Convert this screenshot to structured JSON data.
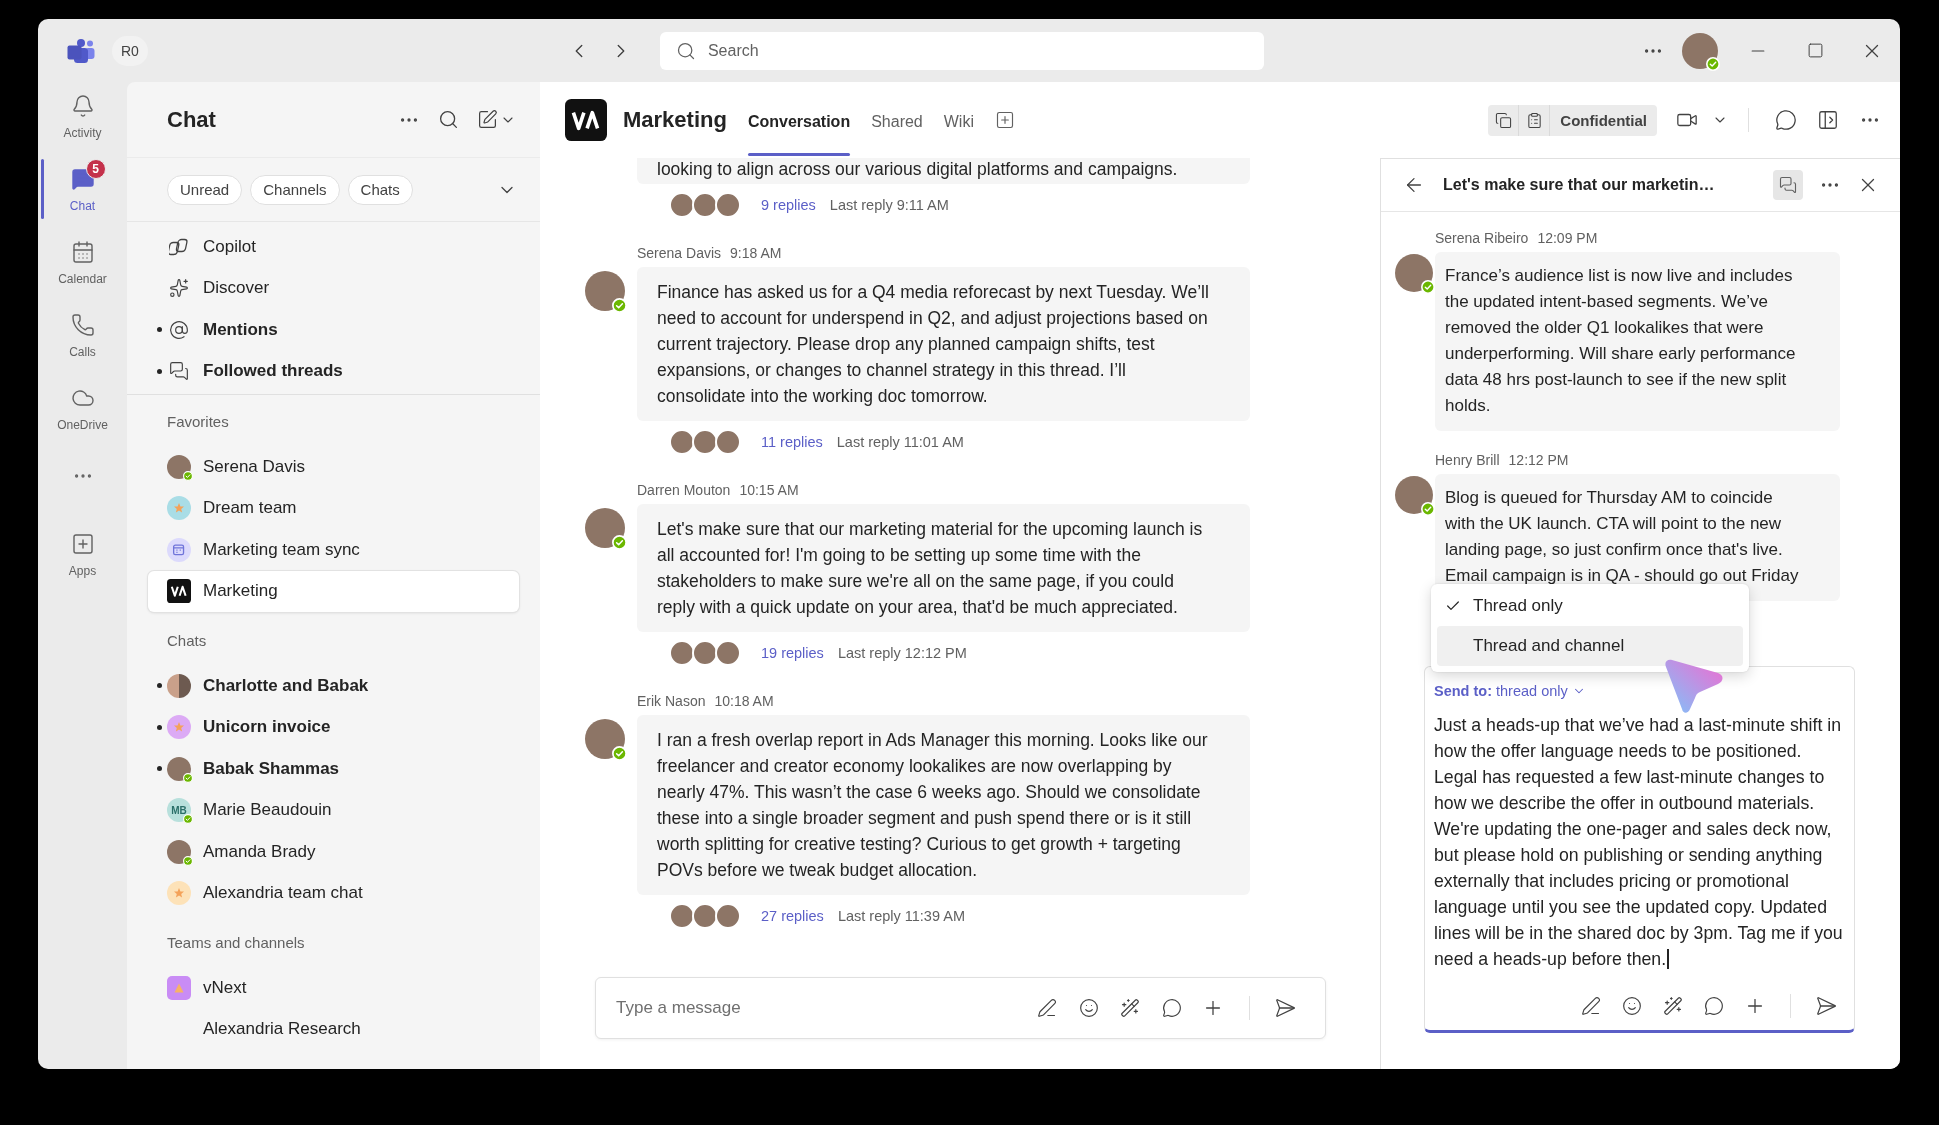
{
  "title_bar": {
    "org_badge": "R0",
    "search": {
      "placeholder": "Search"
    },
    "profile": {
      "kind": "photo",
      "online": true
    }
  },
  "app_rail": [
    {
      "kind": "app",
      "label": "Activity",
      "selected": false
    },
    {
      "kind": "app",
      "label": "Chat",
      "selected": true,
      "badge": "5"
    },
    {
      "kind": "app",
      "label": "Calendar",
      "selected": false
    },
    {
      "kind": "app",
      "label": "Calls",
      "selected": false
    },
    {
      "kind": "app",
      "label": "OneDrive",
      "selected": false
    },
    {
      "kind": "more"
    },
    {
      "kind": "app",
      "label": "Apps",
      "selected": false
    }
  ],
  "sidebar": {
    "title": "Chat",
    "filters": [
      {
        "label": "Unread",
        "selected": false
      },
      {
        "label": "Channels",
        "selected": false
      },
      {
        "label": "Chats",
        "selected": false
      }
    ],
    "quick_links": [
      {
        "label": "Copilot",
        "unread": false,
        "selected": false
      },
      {
        "label": "Discover",
        "unread": false,
        "selected": false
      },
      {
        "label": "Mentions",
        "unread": true,
        "selected": false
      },
      {
        "label": "Followed threads",
        "unread": true,
        "selected": false
      }
    ],
    "sections": [
      {
        "heading": "Favorites",
        "items": [
          {
            "label": "Serena Davis",
            "unread": false,
            "selected": false,
            "avatar": {
              "kind": "photo",
              "online": true
            }
          },
          {
            "label": "Dream team",
            "unread": false,
            "selected": false,
            "avatar": {
              "kind": "group",
              "color": "#a9dde6"
            }
          },
          {
            "label": "Marketing team sync",
            "unread": false,
            "selected": false,
            "avatar": {
              "kind": "meeting"
            }
          },
          {
            "label": "Marketing",
            "unread": false,
            "selected": true,
            "avatar": {
              "kind": "logo"
            }
          }
        ]
      },
      {
        "heading": "Chats",
        "items": [
          {
            "label": "Charlotte and Babak",
            "unread": true,
            "selected": false,
            "avatar": {
              "kind": "pair"
            }
          },
          {
            "label": "Unicorn invoice",
            "unread": true,
            "selected": false,
            "avatar": {
              "kind": "group",
              "color": "#dcaaf5"
            }
          },
          {
            "label": "Babak Shammas",
            "unread": true,
            "selected": false,
            "avatar": {
              "kind": "photo",
              "online": true
            }
          },
          {
            "label": "Marie Beaudouin",
            "unread": false,
            "selected": false,
            "avatar": {
              "kind": "initials",
              "initials": "MB",
              "online": true
            }
          },
          {
            "label": "Amanda Brady",
            "unread": false,
            "selected": false,
            "avatar": {
              "kind": "photo",
              "online": true
            }
          },
          {
            "label": "Alexandria team chat",
            "unread": false,
            "selected": false,
            "avatar": {
              "kind": "group",
              "color": "#fde2b8"
            }
          }
        ]
      },
      {
        "heading": "Teams and channels",
        "items": [
          {
            "label": "vNext",
            "unread": false,
            "selected": false,
            "avatar": {
              "kind": "team",
              "color": "#c98cf5"
            },
            "children": [
              {
                "label": "Alexandria Research",
                "unread": false,
                "selected": false
              }
            ]
          }
        ]
      }
    ]
  },
  "channel": {
    "name": "Marketing",
    "tabs": [
      {
        "label": "Conversation",
        "selected": true
      },
      {
        "label": "Shared",
        "selected": false
      },
      {
        "label": "Wiki",
        "selected": false
      }
    ],
    "sensitivity": "Confidential"
  },
  "conversation": {
    "posts": [
      {
        "text": "looking to align across our various digital platforms and campaigns.",
        "repliers": [
          {
            "kind": "photo"
          },
          {
            "kind": "photo"
          },
          {
            "kind": "photo"
          }
        ],
        "replies": "9 replies",
        "last_reply": "Last reply 9:11 AM"
      },
      {
        "author": "Serena Davis",
        "time": "9:18 AM",
        "avatar": {
          "kind": "photo",
          "online": true
        },
        "text": "Finance has asked us for a Q4 media reforecast by next Tuesday. We’ll need to account for underspend in Q2, and adjust projections based on current trajectory. Please drop any planned campaign shifts, test expansions, or changes to channel strategy in this thread. I’ll consolidate into the working doc tomorrow.",
        "repliers": [
          {
            "kind": "photo"
          },
          {
            "kind": "photo"
          },
          {
            "kind": "photo"
          }
        ],
        "replies": "11 replies",
        "last_reply": "Last reply 11:01 AM"
      },
      {
        "author": "Darren Mouton",
        "time": "10:15 AM",
        "avatar": {
          "kind": "photo",
          "online": true
        },
        "text": "Let's make sure that our marketing material for the upcoming launch is all accounted for! I'm going to be setting up some time with the stakeholders to make sure we're all on the same page, if you could reply with a quick update on your area, that'd be much appreciated.",
        "repliers": [
          {
            "kind": "photo"
          },
          {
            "kind": "photo"
          },
          {
            "kind": "photo"
          }
        ],
        "replies": "19 replies",
        "last_reply": "Last reply 12:12 PM"
      },
      {
        "author": "Erik Nason",
        "time": "10:18 AM",
        "avatar": {
          "kind": "photo",
          "online": true
        },
        "text": "I ran a fresh overlap report in Ads Manager this morning. Looks like our freelancer and creator economy lookalikes are now overlapping by nearly 47%. This wasn’t the case 6 weeks ago. Should we consolidate these into a single broader segment and push spend there or is it still worth splitting for creative testing? Curious to get growth + targeting POVs before we tweak budget allocation.",
        "repliers": [
          {
            "kind": "photo"
          },
          {
            "kind": "photo"
          },
          {
            "kind": "photo"
          }
        ],
        "replies": "27 replies",
        "last_reply": "Last reply 11:39 AM"
      }
    ],
    "compose": {
      "placeholder": "Type a message"
    }
  },
  "thread": {
    "title": "Let's make sure that our marketin…",
    "messages": [
      {
        "author": "Serena Ribeiro",
        "time": "12:09 PM",
        "avatar": {
          "kind": "photo",
          "online": true
        },
        "text": "France’s audience list is now live and includes the updated intent-based segments. We’ve removed the older Q1 lookalikes that were underperforming. Will share early performance data 48 hrs post-launch to see if the new split holds."
      },
      {
        "author": "Henry Brill",
        "time": "12:12 PM",
        "avatar": {
          "kind": "photo",
          "online": true
        },
        "text": "Blog is queued for Thursday AM to coincide with the UK launch. CTA will point to the new landing page, so just confirm once that's live. Email campaign is in QA - should go out Friday"
      }
    ],
    "send_menu": [
      {
        "label": "Thread only",
        "selected": true,
        "hovered": false
      },
      {
        "label": "Thread and channel",
        "selected": false,
        "hovered": true
      }
    ],
    "reply": {
      "send_to_label": "Send to:",
      "send_to_value": "thread only",
      "value": "Just a heads-up that we’ve had a last-minute shift in how the offer language needs to be positioned. Legal has requested a few last-minute changes to how we describe the offer in outbound materials. We're updating the one-pager and sales deck now, but please hold on publishing or sending anything externally that includes pricing or promotional language until you see the updated copy. Updated lines will be in the shared doc by 3pm. Tag me if you need a heads-up before then."
    }
  }
}
